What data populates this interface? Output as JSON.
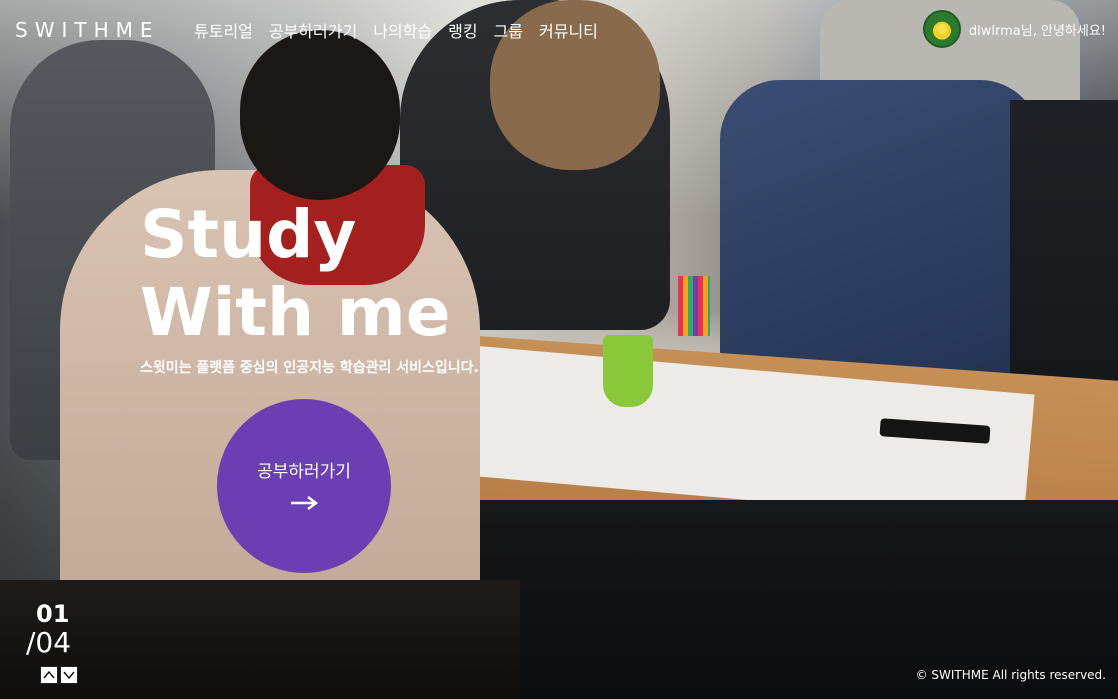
{
  "header": {
    "logo": "SWITHME",
    "nav": [
      "튜토리얼",
      "공부하러가기",
      "나의학습",
      "랭킹",
      "그룹",
      "커뮤니티"
    ],
    "greeting": "dlwlrma님, 안녕하세요!"
  },
  "hero": {
    "title_line1": "Study",
    "title_line2": "With me",
    "subtitle": "스윗미는 플랫폼 중심의 인공지능 학습관리 서비스입니다.",
    "cta_label": "공부하러가기"
  },
  "slider": {
    "current": "01",
    "total": "/04"
  },
  "footer": {
    "copyright": "© SWITHME All rights reserved."
  },
  "colors": {
    "accent": "#6b3fb3",
    "text": "#ffffff"
  },
  "icons": {
    "cta": "arrow-right-icon",
    "prev": "chevron-up-icon",
    "next": "chevron-down-icon",
    "avatar": "user-avatar"
  }
}
